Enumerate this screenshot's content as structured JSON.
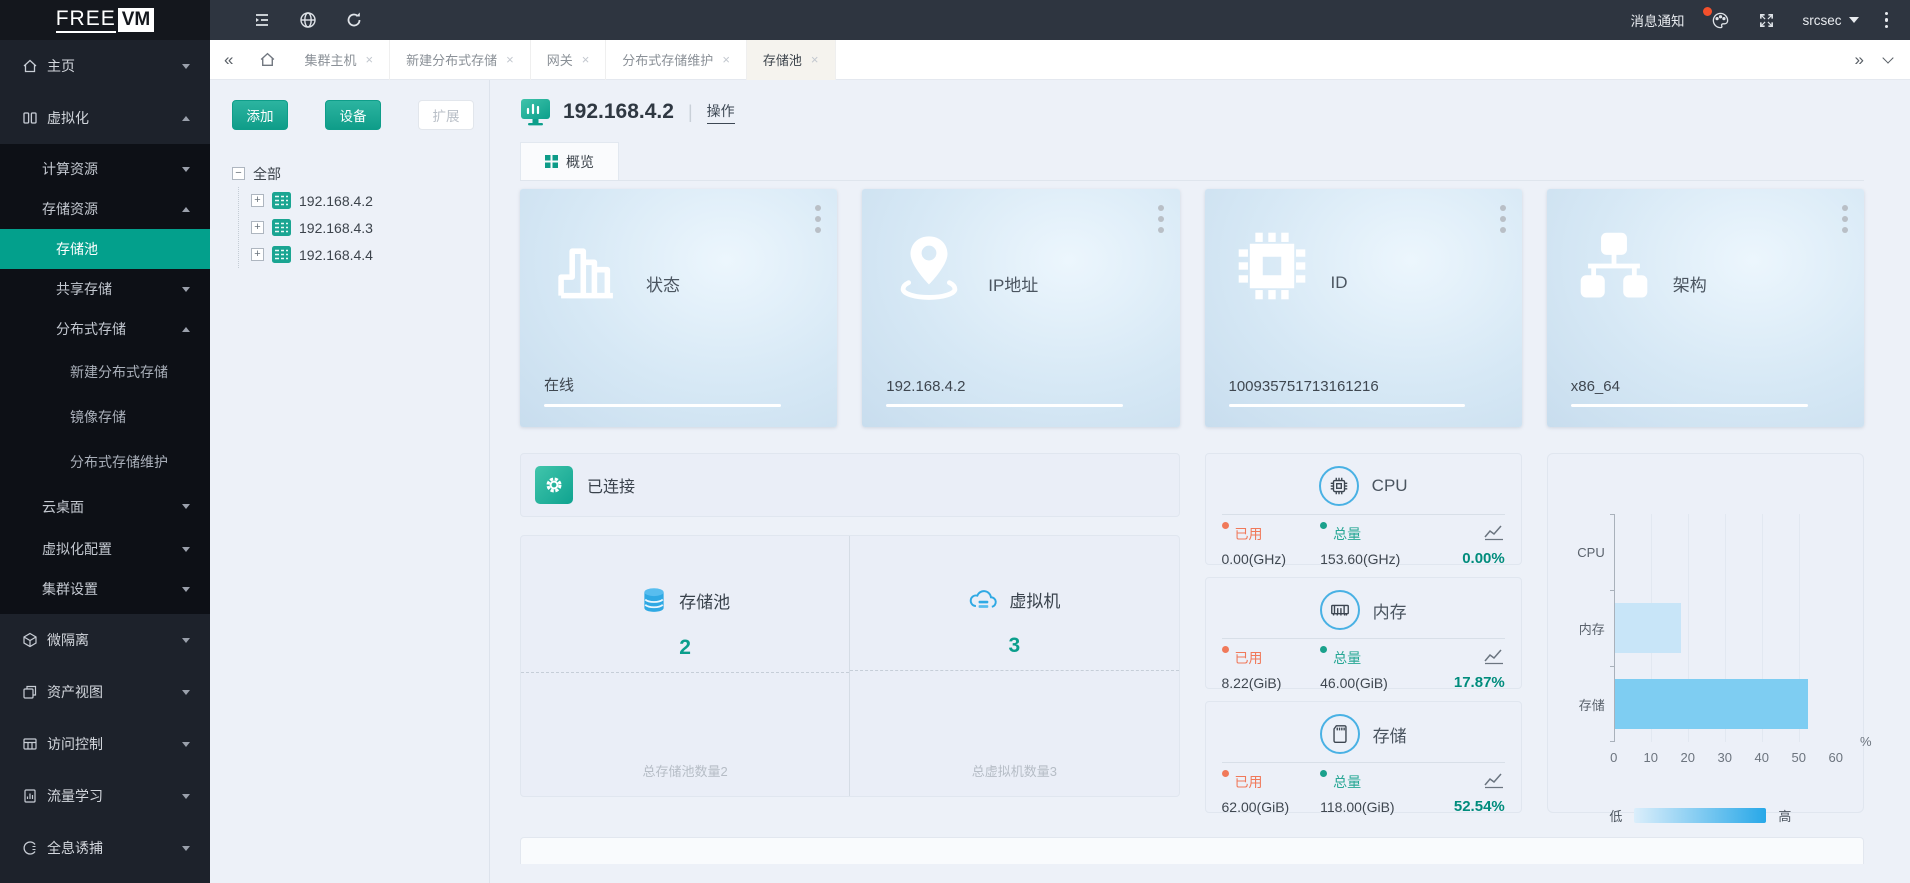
{
  "topbar": {
    "logo_text": "FREE",
    "logo_badge": "VM",
    "notifications_label": "消息通知",
    "username": "srcsec"
  },
  "tabbar": {
    "tabs": [
      {
        "label": "集群主机"
      },
      {
        "label": "新建分布式存储"
      },
      {
        "label": "网关"
      },
      {
        "label": "分布式存储维护"
      },
      {
        "label": "存储池"
      }
    ]
  },
  "sidebar": {
    "items": [
      {
        "label": "主页"
      },
      {
        "label": "虚拟化"
      },
      {
        "label": "计算资源"
      },
      {
        "label": "存储资源"
      },
      {
        "label": "存储池"
      },
      {
        "label": "共享存储"
      },
      {
        "label": "分布式存储"
      },
      {
        "label": "新建分布式存储"
      },
      {
        "label": "镜像存储"
      },
      {
        "label": "分布式存储维护"
      },
      {
        "label": "云桌面"
      },
      {
        "label": "虚拟化配置"
      },
      {
        "label": "集群设置"
      },
      {
        "label": "微隔离"
      },
      {
        "label": "资产视图"
      },
      {
        "label": "访问控制"
      },
      {
        "label": "流量学习"
      },
      {
        "label": "全息诱捕"
      }
    ]
  },
  "tree_panel": {
    "add_button": "添加",
    "device_button": "设备",
    "expand_button": "扩展",
    "root_label": "全部",
    "nodes": [
      "192.168.4.2",
      "192.168.4.3",
      "192.168.4.4"
    ]
  },
  "main": {
    "host": {
      "ip": "192.168.4.2",
      "action_label": "操作"
    },
    "overview_tab": "概览",
    "info_cards": [
      {
        "title": "状态",
        "value": "在线"
      },
      {
        "title": "IP地址",
        "value": "192.168.4.2"
      },
      {
        "title": "ID",
        "value": "100935751713161216"
      },
      {
        "title": "架构",
        "value": "x86_64"
      }
    ],
    "connection_label": "已连接",
    "counters": [
      {
        "title": "存储池",
        "count": "2",
        "footer": "总存储池数量2"
      },
      {
        "title": "虚拟机",
        "count": "3",
        "footer": "总虚拟机数量3"
      }
    ],
    "resource_cards": [
      {
        "title": "CPU",
        "used_label": "已用",
        "used_value": "0.00(GHz)",
        "total_label": "总量",
        "total_value": "153.60(GHz)",
        "percent": "0.00%"
      },
      {
        "title": "内存",
        "used_label": "已用",
        "used_value": "8.22(GiB)",
        "total_label": "总量",
        "total_value": "46.00(GiB)",
        "percent": "17.87%"
      },
      {
        "title": "存储",
        "used_label": "已用",
        "used_value": "62.00(GiB)",
        "total_label": "总量",
        "total_value": "118.00(GiB)",
        "percent": "52.54%"
      }
    ],
    "accent_colors": {
      "sidebar_active_teal": "#03a08c",
      "used_orange": "#f0795a",
      "total_teal": "#27a795",
      "percent_teal": "#008c7c"
    }
  },
  "chart_data": {
    "type": "bar",
    "orientation": "horizontal",
    "categories": [
      "CPU",
      "内存",
      "存储"
    ],
    "values": [
      0,
      17.87,
      52.54
    ],
    "xlim": [
      0,
      60
    ],
    "xticks": [
      0,
      10,
      20,
      30,
      40,
      50,
      60
    ],
    "xlabel": "%",
    "legend_low": "低",
    "legend_high": "高",
    "legend_position": "bottom",
    "grid": true,
    "bar_colors": [
      "#cde7f9",
      "#c8e5f8",
      "#7ecdf2"
    ]
  }
}
